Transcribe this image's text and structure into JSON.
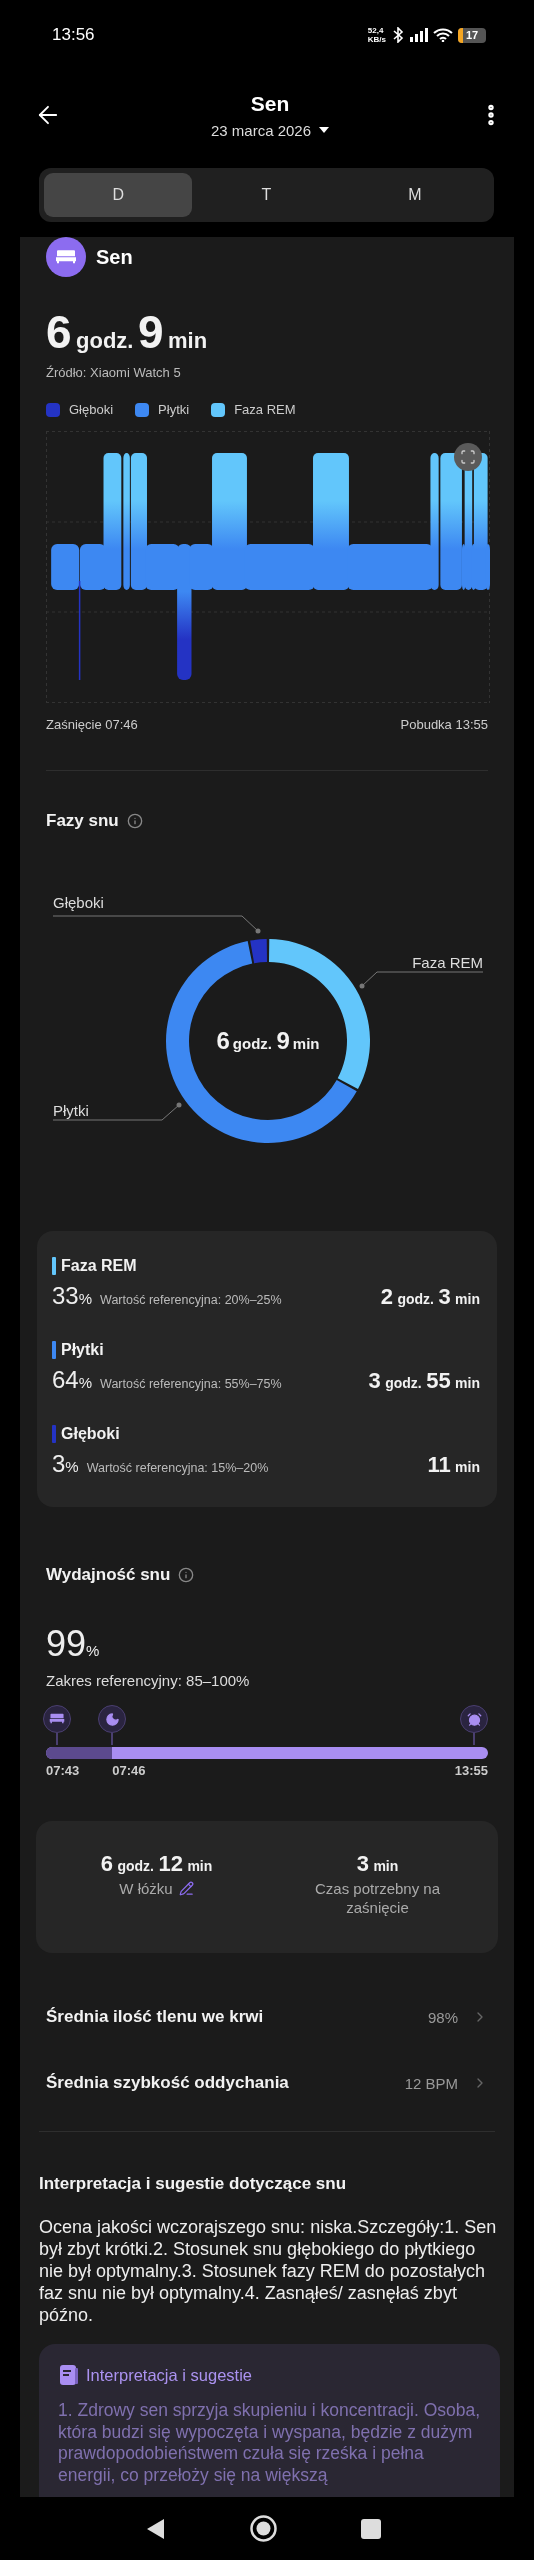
{
  "status_bar": {
    "time": "13:56",
    "speed": "52,4",
    "speed_unit": "KB/s",
    "battery": "17"
  },
  "header": {
    "title": "Sen",
    "date": "23 marca 2026"
  },
  "tabs": [
    {
      "label": "D",
      "selected": true
    },
    {
      "label": "T",
      "selected": false
    },
    {
      "label": "M",
      "selected": false
    }
  ],
  "summary": {
    "title": "Sen",
    "duration": [
      {
        "value": "6",
        "unit": "godz."
      },
      {
        "value": "9",
        "unit": "min"
      }
    ],
    "source": "Źródło: Xiaomi Watch 5",
    "legend": [
      {
        "label": "Głęboki",
        "color": "#2433c4"
      },
      {
        "label": "Płytki",
        "color": "#3d88f2"
      },
      {
        "label": "Faza REM",
        "color": "#62c6fb"
      }
    ],
    "start": "Zaśnięcie 07:46",
    "end": "Pobudka 13:55"
  },
  "phases": {
    "title": "Fazy snu",
    "center": [
      {
        "value": "6",
        "unit": "godz."
      },
      {
        "value": "9",
        "unit": "min"
      }
    ],
    "chart_data": {
      "type": "donut",
      "categories": [
        "Faza REM",
        "Płytki",
        "Głęboki"
      ],
      "values": [
        33,
        64,
        3
      ]
    },
    "items": [
      {
        "name": "Faza REM",
        "color": "#62c6fb",
        "percent": "33",
        "unit": "%",
        "reference": "Wartość referencyjna: 20%–25%",
        "duration": [
          {
            "value": "2",
            "unit": "godz."
          },
          {
            "value": "3",
            "unit": "min"
          }
        ]
      },
      {
        "name": "Płytki",
        "color": "#3d88f2",
        "percent": "64",
        "unit": "%",
        "reference": "Wartość referencyjna: 55%–75%",
        "duration": [
          {
            "value": "3",
            "unit": "godz."
          },
          {
            "value": "55",
            "unit": "min"
          }
        ]
      },
      {
        "name": "Głęboki",
        "color": "#2433c4",
        "percent": "3",
        "unit": "%",
        "reference": "Wartość referencyjna: 15%–20%",
        "duration": [
          {
            "value": "11",
            "unit": "min"
          }
        ]
      }
    ]
  },
  "efficiency": {
    "title": "Wydajność snu",
    "value": "99",
    "unit": "%",
    "range": "Zakres referencyjny: 85–100%",
    "timeline": {
      "level": 0.15,
      "times": [
        "07:43",
        "07:46",
        "13:55"
      ]
    }
  },
  "stats": [
    {
      "duration": [
        {
          "value": "6",
          "unit": "godz."
        },
        {
          "value": "12",
          "unit": "min"
        }
      ],
      "label": "W łóżku",
      "editable": true
    },
    {
      "duration": [
        {
          "value": "3",
          "unit": "min"
        }
      ],
      "label": "Czas potrzebny na zaśnięcie",
      "editable": false
    }
  ],
  "metrics": [
    {
      "label": "Średnia ilość tlenu we krwi",
      "value": "98%"
    },
    {
      "label": "Średnia szybkość oddychania",
      "value": "12 BPM"
    }
  ],
  "interpretation": {
    "title": "Interpretacja i sugestie dotyczące snu",
    "text": "Ocena jakości wczorajszego snu: niska.Szczegóły:1. Sen był zbyt krótki.2. Stosunek snu głębokiego do płytkiego nie był optymalny.3. Stosunek fazy REM do pozostałych faz snu nie był optymalny.4. Zasnąłeś/ zasnęłaś zbyt późno.",
    "card": {
      "title": "Interpretacja i sugestie",
      "text": "1. Zdrowy sen sprzyja skupieniu i koncentracji. Osoba, która budzi się wypoczęta i wyspana, będzie z dużym prawdopodobieństwem czuła się rześka i pełna energii, co przełoży się na większą"
    }
  }
}
